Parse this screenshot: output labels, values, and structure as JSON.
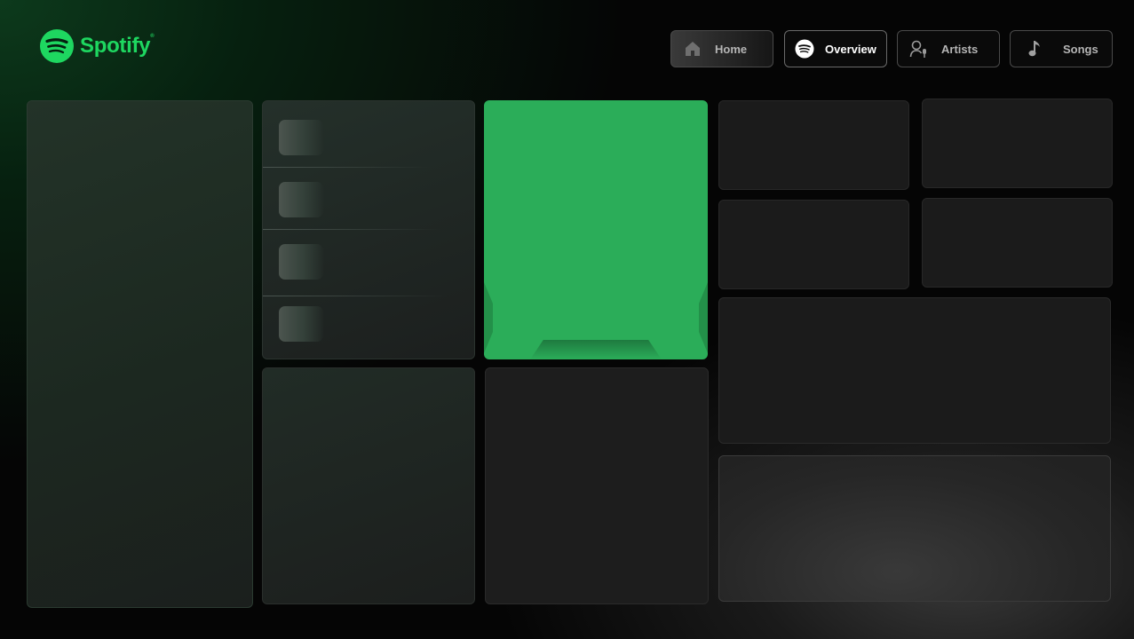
{
  "brand": {
    "name": "Spotify",
    "trademark": "®",
    "color": "#1ed760"
  },
  "nav": {
    "items": [
      {
        "label": "Home",
        "icon": "home-icon"
      },
      {
        "label": "Overview",
        "icon": "spotify-icon"
      },
      {
        "label": "Artists",
        "icon": "artist-mic-icon"
      },
      {
        "label": "Songs",
        "icon": "music-note-icon"
      }
    ],
    "active": "Overview"
  },
  "colors": {
    "accent_green": "#2bad59",
    "background": "#050505",
    "card": "#1b1b1b"
  }
}
